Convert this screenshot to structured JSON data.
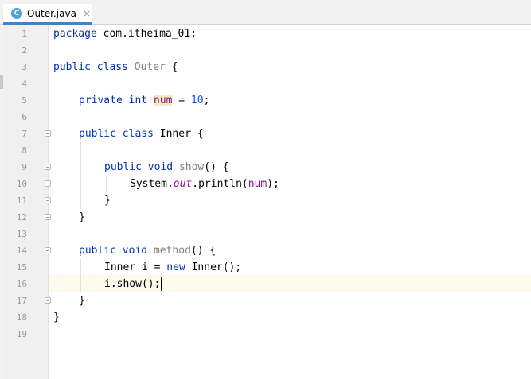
{
  "tab": {
    "icon_letter": "C",
    "filename": "Outer.java",
    "close": "×"
  },
  "gutter": {
    "line_numbers": [
      "1",
      "2",
      "3",
      "4",
      "5",
      "6",
      "7",
      "8",
      "9",
      "10",
      "11",
      "12",
      "13",
      "14",
      "15",
      "16",
      "17",
      "18",
      "19"
    ]
  },
  "code": {
    "l1": {
      "kw": "package",
      "rest": " com.itheima_01;"
    },
    "l3": {
      "kw1": "public",
      "kw2": "class",
      "name": "Outer",
      "rest": " {"
    },
    "l5": {
      "kw1": "private",
      "kw2": "int",
      "field": "num",
      "eq": " = ",
      "value": "10",
      "semi": ";"
    },
    "l7": {
      "kw1": "public",
      "kw2": "class",
      "rest": " Inner {"
    },
    "l9": {
      "kw1": "public",
      "kw2": "void",
      "name": "show",
      "rest": "() {"
    },
    "l10": {
      "pre": "System.",
      "static": "out",
      "mid": ".println(",
      "field": "num",
      "post": ");"
    },
    "l11": {
      "text": "}"
    },
    "l12": {
      "text": "}"
    },
    "l14": {
      "kw1": "public",
      "kw2": "void",
      "name": "method",
      "rest": "() {"
    },
    "l15": {
      "pre": "Inner i = ",
      "kw": "new",
      "post": " Inner();"
    },
    "l16": {
      "text": "i.show();"
    },
    "l17": {
      "text": "}"
    },
    "l18": {
      "text": "}"
    }
  },
  "colors": {
    "keyword": "#0033b3",
    "number": "#1750eb",
    "field": "#871094",
    "current_line": "#fcfaed",
    "tab_underline": "#4083c9"
  }
}
